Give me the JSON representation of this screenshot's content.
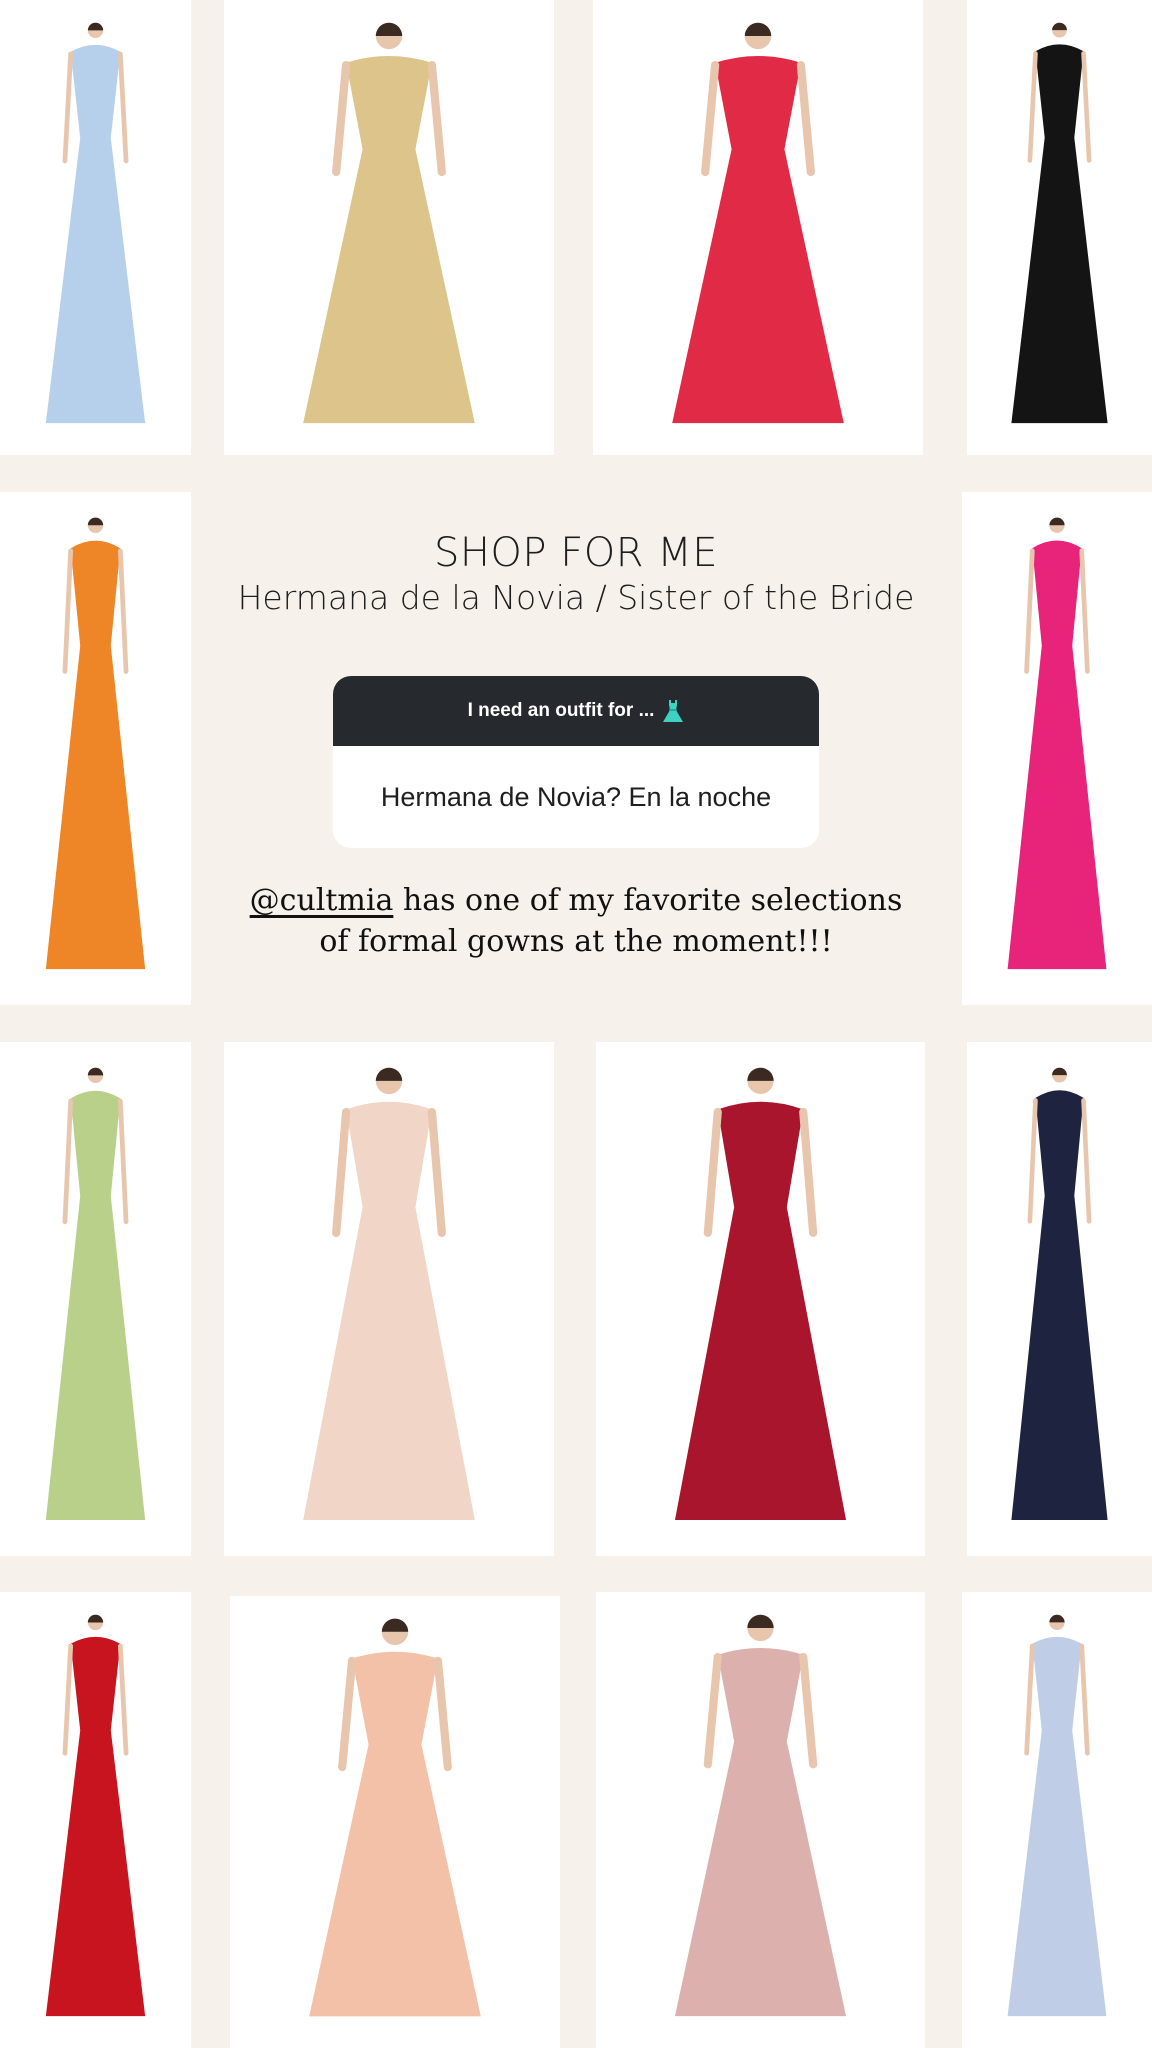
{
  "story": {
    "title": "SHOP FOR ME",
    "subtitle": "Hermana de la Novia / Sister of the Bride"
  },
  "question_box": {
    "prompt": "I need an outfit for ...",
    "prompt_icon": "dress-emoji-icon",
    "answer": "Hermana de Novia? En la noche"
  },
  "caption": {
    "handle": "@cultmia",
    "line1_rest": " has one of my favorite selections",
    "line2": "of formal gowns at the moment!!!"
  },
  "products": [
    {
      "name": "light-blue-cape-gown",
      "color": "#b6d0ec"
    },
    {
      "name": "gold-cape-gown",
      "color": "#dcc48a"
    },
    {
      "name": "red-embroidered-gown",
      "color": "#e12a45"
    },
    {
      "name": "black-strapless-gown",
      "color": "#141414"
    },
    {
      "name": "orange-peplum-gown",
      "color": "#ee8527"
    },
    {
      "name": "pink-cape-gown",
      "color": "#e8237a"
    },
    {
      "name": "green-draped-gown",
      "color": "#b9d08a"
    },
    {
      "name": "blush-train-gown",
      "color": "#f1d5c6"
    },
    {
      "name": "burgundy-ballgown",
      "color": "#a8152c"
    },
    {
      "name": "navy-lace-ballgown",
      "color": "#1e2340"
    },
    {
      "name": "red-draped-gown",
      "color": "#c8141f"
    },
    {
      "name": "peach-bow-gown",
      "color": "#f3c0a8"
    },
    {
      "name": "blush-satin-gown",
      "color": "#dcb1ad"
    },
    {
      "name": "lavender-cape-gown",
      "color": "#bfcde6"
    }
  ]
}
